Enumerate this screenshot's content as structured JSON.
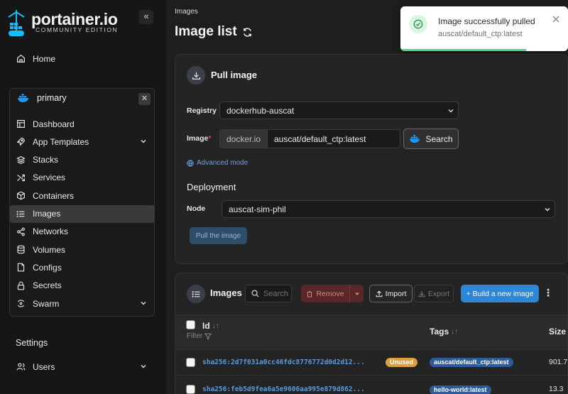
{
  "sidebar": {
    "logo": {
      "text": "portainer.io",
      "subtitle": "COMMUNITY EDITION"
    },
    "collapse_glyph": "«",
    "home": "Home",
    "environment": {
      "name": "primary",
      "close_glyph": "✕"
    },
    "items": [
      {
        "label": "Dashboard",
        "icon": "dashboard-icon"
      },
      {
        "label": "App Templates",
        "icon": "rocket-icon",
        "expandable": true
      },
      {
        "label": "Stacks",
        "icon": "layers-icon"
      },
      {
        "label": "Services",
        "icon": "shuffle-icon"
      },
      {
        "label": "Containers",
        "icon": "box-icon"
      },
      {
        "label": "Images",
        "icon": "list-icon",
        "active": true
      },
      {
        "label": "Networks",
        "icon": "share-icon"
      },
      {
        "label": "Volumes",
        "icon": "database-icon"
      },
      {
        "label": "Configs",
        "icon": "file-icon"
      },
      {
        "label": "Secrets",
        "icon": "lock-icon"
      },
      {
        "label": "Swarm",
        "icon": "swarm-icon",
        "expandable": true
      }
    ],
    "settings_heading": "Settings",
    "users": "Users"
  },
  "header": {
    "breadcrumb": "Images",
    "title": "Image list"
  },
  "pull": {
    "title": "Pull image",
    "registry_label": "Registry",
    "registry_value": "dockerhub-auscat",
    "image_label": "Image",
    "required_mark": "*",
    "image_prefix": "docker.io",
    "image_value": "auscat/default_ctp:latest",
    "search_label": "Search",
    "advanced_mode": "Advanced mode",
    "deployment_title": "Deployment",
    "node_label": "Node",
    "node_value": "auscat-sim-phil",
    "pull_button": "Pull the image"
  },
  "images_table": {
    "title": "Images",
    "search_placeholder": "Search...",
    "remove_label": "Remove",
    "import_label": "Import",
    "export_label": "Export",
    "build_label": "+ Build a new image",
    "columns": {
      "id": "Id",
      "tags": "Tags",
      "size": "Size"
    },
    "filter_label": "Filter",
    "rows": [
      {
        "id": "sha256:2d7f031a0cc46fdc8776772d0d2d12...",
        "unused": "Unused",
        "tag": "auscat/default_ctp:latest",
        "size": "901.7"
      },
      {
        "id": "sha256:feb5d9fea6a5e9606aa995e879d862...",
        "unused": "",
        "tag": "hello-world:latest",
        "size": "13.3"
      }
    ]
  },
  "toast": {
    "title": "Image successfully pulled",
    "subtitle": "auscat/default_ctp:latest",
    "progress_fraction": 0.75
  },
  "colors": {
    "accent": "#2f86d4",
    "danger": "#5a2626",
    "warning": "#dc9f3a",
    "tag": "#2c5d9a",
    "success": "#4ade80"
  }
}
